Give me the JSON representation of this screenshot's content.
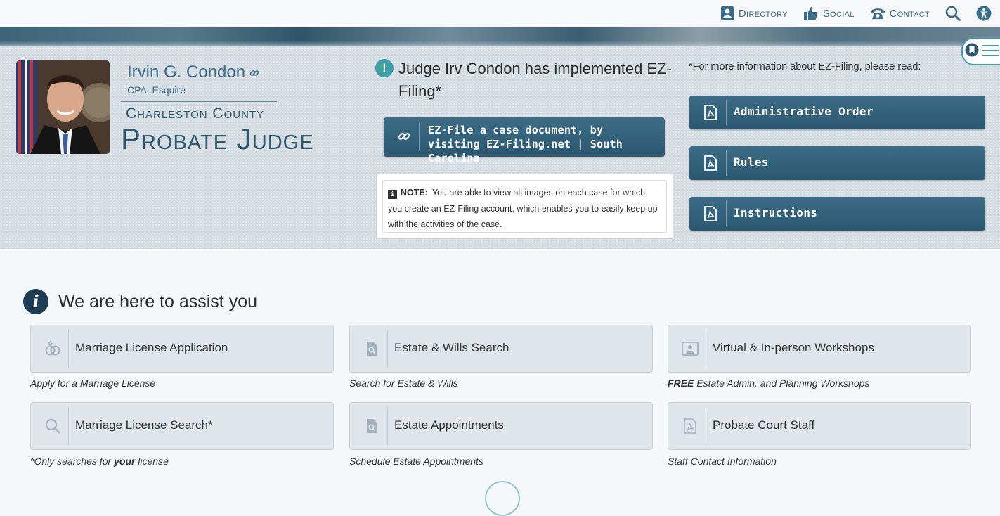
{
  "topnav": {
    "directory": "Directory",
    "social": "Social",
    "contact": "Contact",
    "icons": [
      "directory-icon",
      "thumbs-up-icon",
      "phone-icon",
      "search-icon",
      "accessibility-icon"
    ]
  },
  "judge": {
    "name": "Irvin G. Condon",
    "credentials": "CPA, Esquire",
    "county": "Charleston County",
    "title": "Probate Judge"
  },
  "announcement": {
    "text": "Judge Irv Condon has implemented EZ-Filing*",
    "ez_button": "EZ-File a case document, by visiting EZ-Filing.net | South Carolina",
    "note_label": "NOTE:",
    "note_text": "You are able to view all images on each case for which you create an EZ-Filing account, which enables you to easily keep up with the activities of the case."
  },
  "docs": {
    "info": "*For more information about EZ-Filing, please read:",
    "buttons": [
      "Administrative Order",
      "Rules",
      "Instructions"
    ]
  },
  "assist": {
    "title": "We are here to assist you",
    "cards": [
      {
        "label": "Marriage License Application",
        "caption": "Apply for a Marriage License",
        "icon": "rings-icon"
      },
      {
        "label": "Estate & Wills Search",
        "caption": "Search for Estate & Wills",
        "icon": "file-search-icon"
      },
      {
        "label": "Virtual & In-person Workshops",
        "caption_bold": "FREE",
        "caption": "Estate Admin. and Planning Workshops",
        "icon": "workshop-icon"
      },
      {
        "label": "Marriage License Search*",
        "caption_pre": "*Only searches for",
        "caption_bold": "your",
        "caption_post": "license",
        "icon": "search-icon"
      },
      {
        "label": "Estate Appointments",
        "caption": "Schedule Estate Appointments",
        "icon": "file-search-icon"
      },
      {
        "label": "Probate Court Staff",
        "caption": "Staff Contact Information",
        "icon": "pdf-icon"
      }
    ]
  },
  "colors": {
    "brand": "#2c5870",
    "button": "#34637c",
    "accent": "#3ea0a6",
    "hero_bg": "#d6dde2"
  }
}
